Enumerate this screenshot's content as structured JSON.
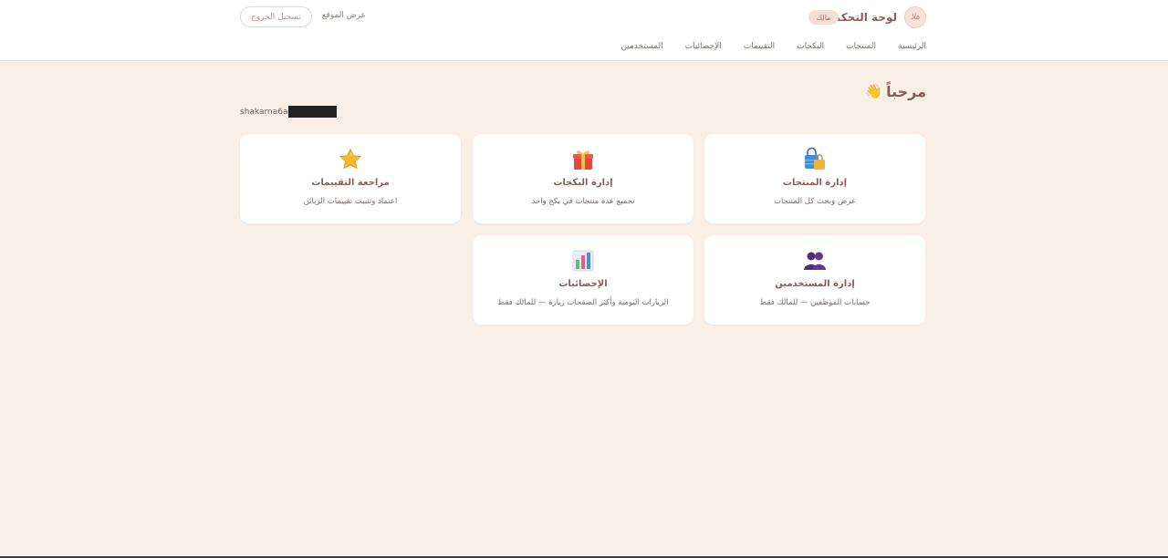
{
  "header": {
    "title": "لوحة التحكم",
    "role_badge": "مالك",
    "view_site": "عرض الموقع",
    "logout": "تسجيل الخروج",
    "logo_text": "هلا"
  },
  "nav": {
    "items": [
      {
        "label": "الرئيسية"
      },
      {
        "label": "المنتجات"
      },
      {
        "label": "البكجات"
      },
      {
        "label": "التقييمات"
      },
      {
        "label": "الإحصائيات"
      },
      {
        "label": "المستخدمين"
      }
    ]
  },
  "welcome": {
    "greeting": "مرحباً",
    "wave_icon": "👋",
    "email_visible": "shakarna6a"
  },
  "cards": [
    {
      "title": "إدارة المنتجات",
      "desc": "عرض وبحث كل المنتجات",
      "icon": "shopping-bags-icon"
    },
    {
      "title": "إدارة البكجات",
      "desc": "تجميع عدة منتجات في بكج واحد",
      "icon": "gift-icon"
    },
    {
      "title": "مراجعة التقييمات",
      "desc": "اعتماد وتثبيت تقييمات الزبائن",
      "icon": "star-icon"
    },
    {
      "title": "إدارة المستخدمين",
      "desc": "حسابات الموظفين — للمالك فقط",
      "icon": "users-icon"
    },
    {
      "title": "الإحصائيات",
      "desc": "الزيارات اليومية وأكثر الصفحات زيارة — للمالك فقط",
      "icon": "bar-chart-icon"
    }
  ],
  "colors": {
    "background": "#faefe6",
    "card": "#ffffff",
    "accent": "#8d5b56",
    "badge": "#f4ddd5"
  }
}
